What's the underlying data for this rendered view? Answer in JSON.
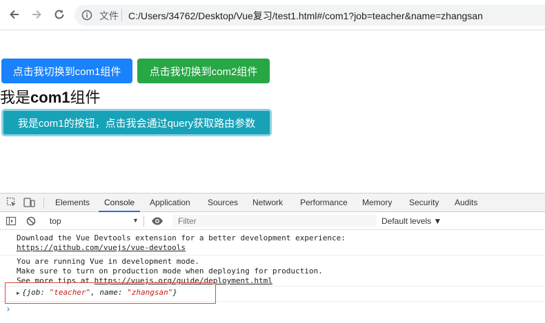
{
  "browser": {
    "scheme_label": "文件",
    "url": "C:/Users/34762/Desktop/Vue复习/test1.html#/com1?job=teacher&name=zhangsan",
    "icons": [
      "back-arrow-icon",
      "forward-arrow-icon",
      "reload-icon",
      "info-icon"
    ]
  },
  "page": {
    "btn_com1": "点击我切换到com1组件",
    "btn_com2": "点击我切换到com2组件",
    "heading_prefix": "我是",
    "heading_bold": "com1",
    "heading_suffix": "组件",
    "btn_query": "我是com1的按钮，点击我会通过query获取路由参数",
    "colors": {
      "primary": "#1a82fb",
      "success": "#28a745",
      "info": "#17a2b8"
    }
  },
  "devtools": {
    "tabs": [
      "Elements",
      "Console",
      "Application",
      "Sources",
      "Network",
      "Performance",
      "Memory",
      "Security",
      "Audits"
    ],
    "active_tab": "Console",
    "context": "top",
    "filter_placeholder": "Filter",
    "levels": "Default levels ▼",
    "logs": [
      {
        "line1": "Download the Vue Devtools extension for a better development experience:",
        "link": "https://github.com/vuejs/vue-devtools"
      },
      {
        "line1": "You are running Vue in development mode.",
        "line2": "Make sure to turn on production mode when deploying for production.",
        "line3_prefix": "See more tips at ",
        "link": "https://vuejs.org/guide/deployment.html"
      }
    ],
    "object": {
      "open": "{job: ",
      "job": "\"teacher\"",
      "mid": ", name: ",
      "name": "\"zhangsan\"",
      "close": "}"
    },
    "prompt": "›"
  }
}
